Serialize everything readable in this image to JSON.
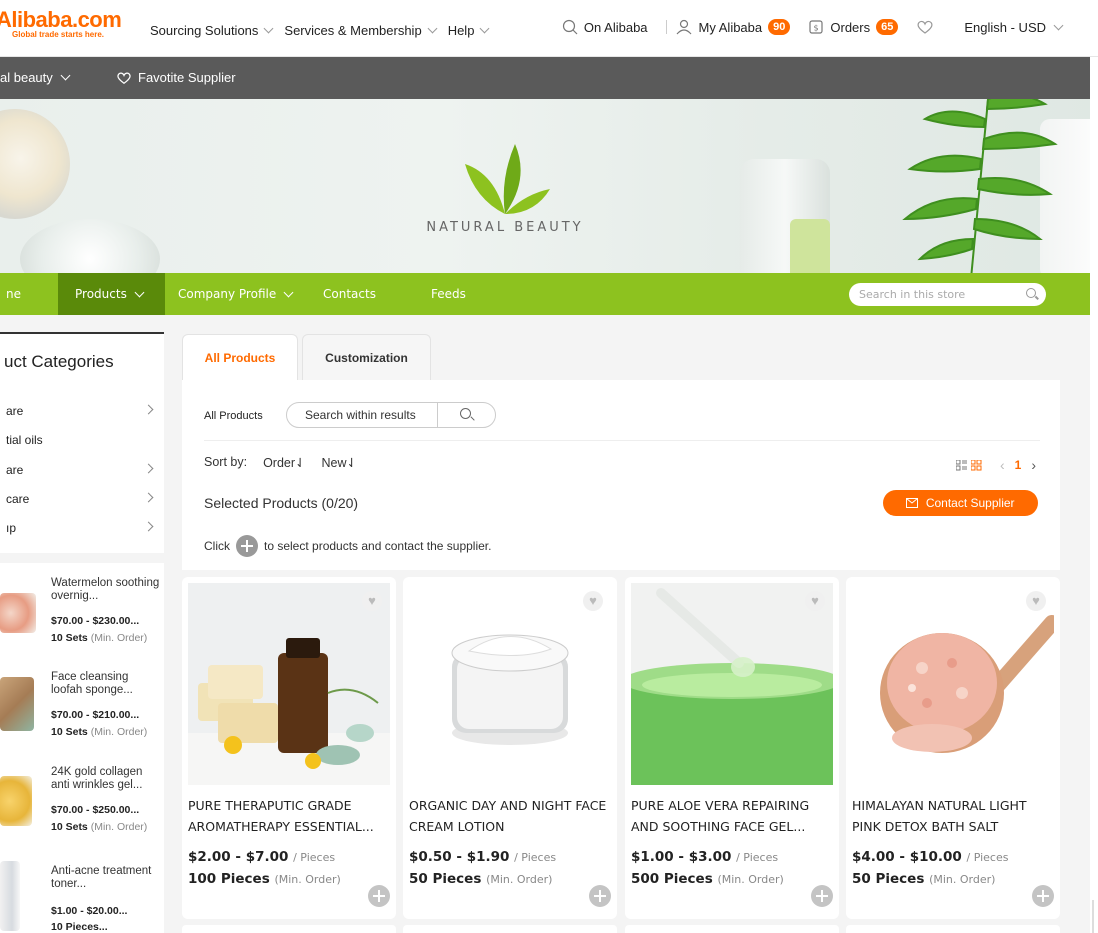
{
  "header": {
    "logo_text": "Alibaba.com",
    "tagline": "Global trade starts here.",
    "nav": [
      "Sourcing Solutions",
      "Services & Membership",
      "Help"
    ],
    "on_alibaba": "On Alibaba",
    "my_alibaba": "My Alibaba",
    "my_alibaba_count": "90",
    "orders": "Orders",
    "orders_count": "65",
    "language": "English - USD"
  },
  "subbar": {
    "store_crumb": "al beauty",
    "favorite": "Favotite Supplier"
  },
  "banner": {
    "title": "NATURAL BEAUTY"
  },
  "store_nav": {
    "home": "ne",
    "products": "Products",
    "company_profile": "Company Profile",
    "contacts": "Contacts",
    "feeds": "Feeds",
    "search_placeholder": "Search in this store"
  },
  "categories": {
    "title": "uct Categories",
    "items": [
      {
        "label": "are",
        "has_arrow": true
      },
      {
        "label": "tial oils",
        "has_arrow": false
      },
      {
        "label": "are",
        "has_arrow": true
      },
      {
        "label": "care",
        "has_arrow": true
      },
      {
        "label": "ıp",
        "has_arrow": true
      }
    ]
  },
  "side_products": [
    {
      "name": "Watermelon soothing overnig...",
      "price": "$70.00 - $230.00...",
      "moq": "10 Sets",
      "moq_note": "(Min. Order)"
    },
    {
      "name": "Face cleansing loofah sponge...",
      "price": "$70.00 - $210.00...",
      "moq": "10 Sets",
      "moq_note": "(Min. Order)"
    },
    {
      "name": "24K gold collagen anti wrinkles gel...",
      "price": "$70.00 - $250.00...",
      "moq": "10 Sets",
      "moq_note": "(Min. Order)"
    },
    {
      "name": "Anti-acne treatment toner...",
      "price": "$1.00 - $20.00...",
      "moq": "10 Pieces...",
      "moq_note": ""
    }
  ],
  "tabs": {
    "all_products": "All Products",
    "customization": "Customization"
  },
  "filters": {
    "label": "All Products",
    "search_placeholder": "Search within results",
    "sort_by": "Sort by:",
    "sort_order": "Order⇃",
    "sort_new": "New⇃",
    "page": "1",
    "selected": "Selected Products (0/20)",
    "contact_supplier": "Contact Supplier",
    "click_prefix": "Click",
    "click_suffix": "to select products and contact the supplier."
  },
  "products": [
    {
      "name": "PURE THERAPUTIC GRADE AROMATHERAPY ESSENTIAL...",
      "price": "$2.00 - $7.00",
      "price_unit": "/ Pieces",
      "moq": "100 Pieces",
      "moq_note": "(Min. Order)"
    },
    {
      "name": "ORGANIC DAY AND NIGHT FACE CREAM LOTION",
      "price": "$0.50 - $1.90",
      "price_unit": "/ Pieces",
      "moq": "50 Pieces",
      "moq_note": "(Min. Order)"
    },
    {
      "name": "PURE ALOE VERA REPAIRING AND SOOTHING FACE GEL...",
      "price": "$1.00 - $3.00",
      "price_unit": "/ Pieces",
      "moq": "500 Pieces",
      "moq_note": "(Min. Order)"
    },
    {
      "name": "HIMALAYAN NATURAL LIGHT PINK DETOX BATH SALT",
      "price": "$4.00 - $10.00",
      "price_unit": "/ Pieces",
      "moq": "50 Pieces",
      "moq_note": "(Min. Order)"
    }
  ],
  "colors": {
    "brand_orange": "#ff6a00",
    "store_green": "#8dc21f",
    "store_green_active": "#5a8a0a",
    "dark_bar": "#5a5a5a"
  }
}
